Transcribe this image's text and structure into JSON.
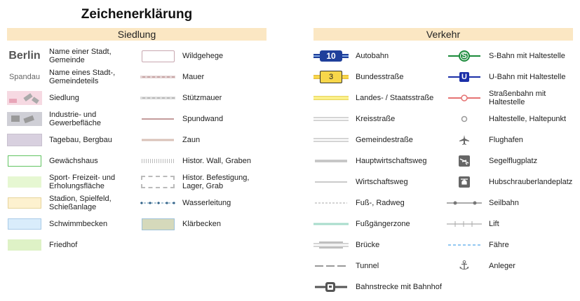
{
  "title": "Zeichenerklärung",
  "sections": {
    "siedlung": "Siedlung",
    "verkehr": "Verkehr"
  },
  "siedlung_col1": [
    {
      "sample": "Berlin",
      "label": "Name einer Stadt, Gemeinde"
    },
    {
      "sample": "Spandau",
      "label": "Name eines Stadt-, Gemeindeteils"
    },
    {
      "label": "Siedlung"
    },
    {
      "label": "Industrie- und Gewerbefläche"
    },
    {
      "label": "Tagebau, Bergbau"
    },
    {
      "label": "Gewächshaus"
    },
    {
      "label": "Sport- Freizeit- und Erholungsfläche"
    },
    {
      "label": "Stadion, Spielfeld, Schießanlage"
    },
    {
      "label": "Schwimmbecken"
    },
    {
      "label": "Friedhof"
    }
  ],
  "siedlung_col2": [
    {
      "label": "Wildgehege"
    },
    {
      "label": "Mauer"
    },
    {
      "label": "Stützmauer"
    },
    {
      "label": "Spundwand"
    },
    {
      "label": "Zaun"
    },
    {
      "label": "Histor. Wall, Graben"
    },
    {
      "label": "Histor. Befestigung, Lager, Grab"
    },
    {
      "label": "Wasserleitung"
    },
    {
      "label": "Klärbecken"
    }
  ],
  "verkehr_col1": [
    {
      "label": "Autobahn",
      "shield": "10"
    },
    {
      "label": "Bundesstraße",
      "shield": "3"
    },
    {
      "label": "Landes- / Staatsstraße"
    },
    {
      "label": "Kreisstraße"
    },
    {
      "label": "Gemeindestraße"
    },
    {
      "label": "Hauptwirtschaftsweg"
    },
    {
      "label": "Wirtschaftsweg"
    },
    {
      "label": "Fuß-, Radweg"
    },
    {
      "label": "Fußgängerzone"
    },
    {
      "label": "Brücke"
    },
    {
      "label": "Tunnel"
    },
    {
      "label": "Bahnstrecke mit Bahnhof"
    }
  ],
  "verkehr_col2": [
    {
      "label": "S-Bahn mit Haltestelle",
      "glyph": "S"
    },
    {
      "label": "U-Bahn mit Haltestelle",
      "glyph": "U"
    },
    {
      "label": "Straßenbahn mit Haltestelle"
    },
    {
      "label": "Haltestelle, Haltepunkt"
    },
    {
      "label": "Flughafen",
      "icon": "airplane-icon"
    },
    {
      "label": "Segelflugplatz",
      "icon": "glider-icon"
    },
    {
      "label": "Hubschrauberlandeplatz",
      "icon": "helicopter-icon"
    },
    {
      "label": "Seilbahn"
    },
    {
      "label": "Lift"
    },
    {
      "label": "Fähre"
    },
    {
      "label": "Anleger",
      "icon": "anchor-icon"
    }
  ],
  "colors": {
    "header_bg": "#fbe7c3",
    "autobahn": "#1f3f9b",
    "bundesstrasse": "#f7d64a",
    "landesstrasse": "#fbf08a",
    "sbahn": "#1a8a3a",
    "ubahn": "#1b2fa8",
    "tram": "#e57373",
    "faehre": "#6fb6ee",
    "fussgaengerzone": "#a8dccc",
    "siedlung": "#f6d9e2",
    "industrie": "#cfcfd6",
    "tagebau": "#d8d0df",
    "sport": "#e6f7d2",
    "stadion": "#fdf1cf",
    "schwimmbecken": "#d9ecfb",
    "friedhof": "#def2c6"
  }
}
